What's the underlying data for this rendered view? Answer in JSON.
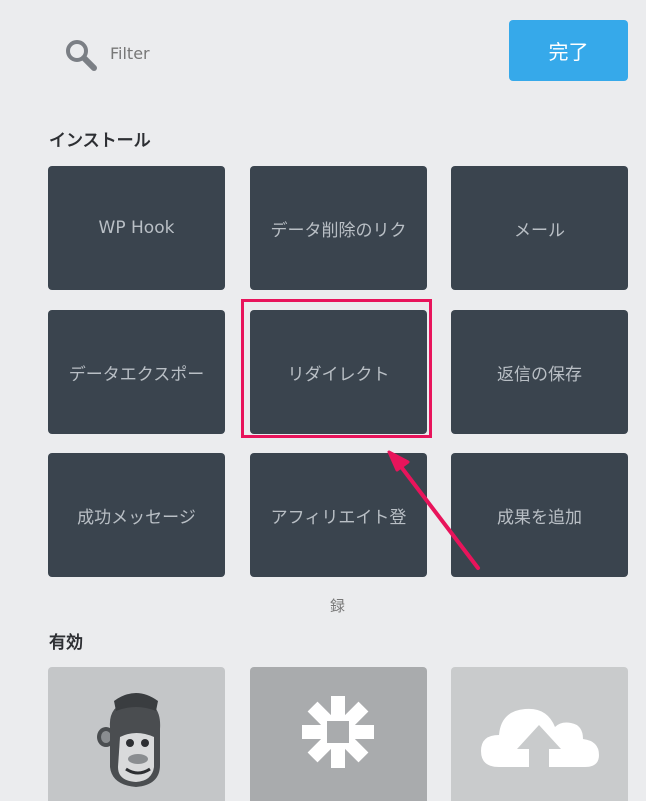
{
  "search": {
    "placeholder": "Filter",
    "value": ""
  },
  "done_button": {
    "label": "完了"
  },
  "installed": {
    "title": "インストール",
    "tiles": [
      "WP Hook",
      "データ削除のリク",
      "メール",
      "データエクスポー",
      "リダイレクト",
      "返信の保存",
      "成功メッセージ",
      "アフィリエイト登",
      "成果を追加"
    ],
    "overflow_text": "録"
  },
  "active": {
    "title": "有効",
    "tiles": [
      {
        "icon": "mailchimp-icon"
      },
      {
        "icon": "zapier-icon"
      },
      {
        "icon": "cloud-upload-icon"
      }
    ]
  },
  "annotation": {
    "highlight_color": "#e8145b"
  },
  "colors": {
    "background": "#ebecee",
    "accent": "#36a9ea",
    "tile": "#3a444e",
    "tile_text": "#b9bfc5"
  }
}
